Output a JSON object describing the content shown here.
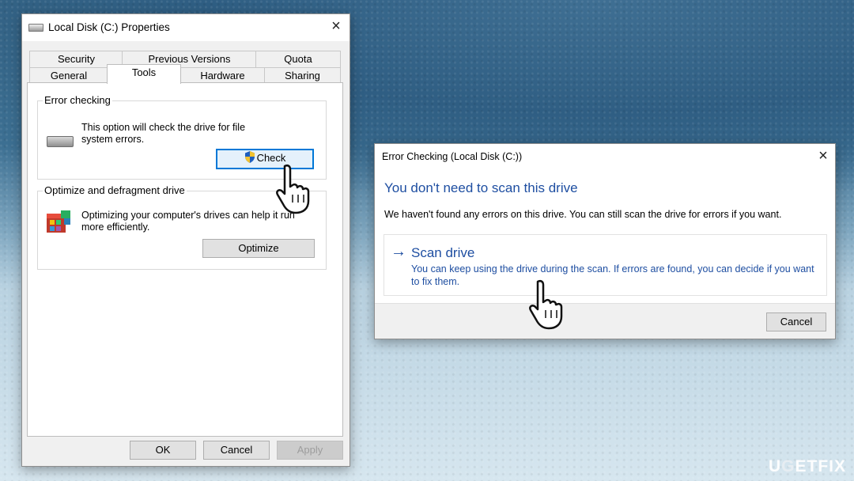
{
  "properties": {
    "title": "Local Disk (C:) Properties",
    "tabs_row1": [
      "Security",
      "Previous Versions",
      "Quota"
    ],
    "tabs_row2": [
      "General",
      "Tools",
      "Hardware",
      "Sharing"
    ],
    "active_tab": "Tools",
    "error_checking": {
      "title": "Error checking",
      "text": "This option will check the drive for file system errors.",
      "button": "Check"
    },
    "optimize": {
      "title": "Optimize and defragment drive",
      "text": "Optimizing your computer's drives can help it run more efficiently.",
      "button": "Optimize"
    },
    "footer": {
      "ok": "OK",
      "cancel": "Cancel",
      "apply": "Apply"
    }
  },
  "error_dialog": {
    "title": "Error Checking (Local Disk (C:))",
    "headline": "You don't need to scan this drive",
    "description": "We haven't found any errors on this drive. You can still scan the drive for errors if you want.",
    "scan_title": "Scan drive",
    "scan_desc": "You can keep using the drive during the scan. If errors are found, you can decide if you want to fix them.",
    "cancel": "Cancel"
  },
  "watermark": {
    "u": "U",
    "g": "G",
    "e": "E",
    "rest": "TFIX"
  },
  "icons": [
    "drive-icon",
    "shield-icon",
    "defrag-icon",
    "arrow-right-icon",
    "close-icon",
    "hand-cursor-icon"
  ]
}
